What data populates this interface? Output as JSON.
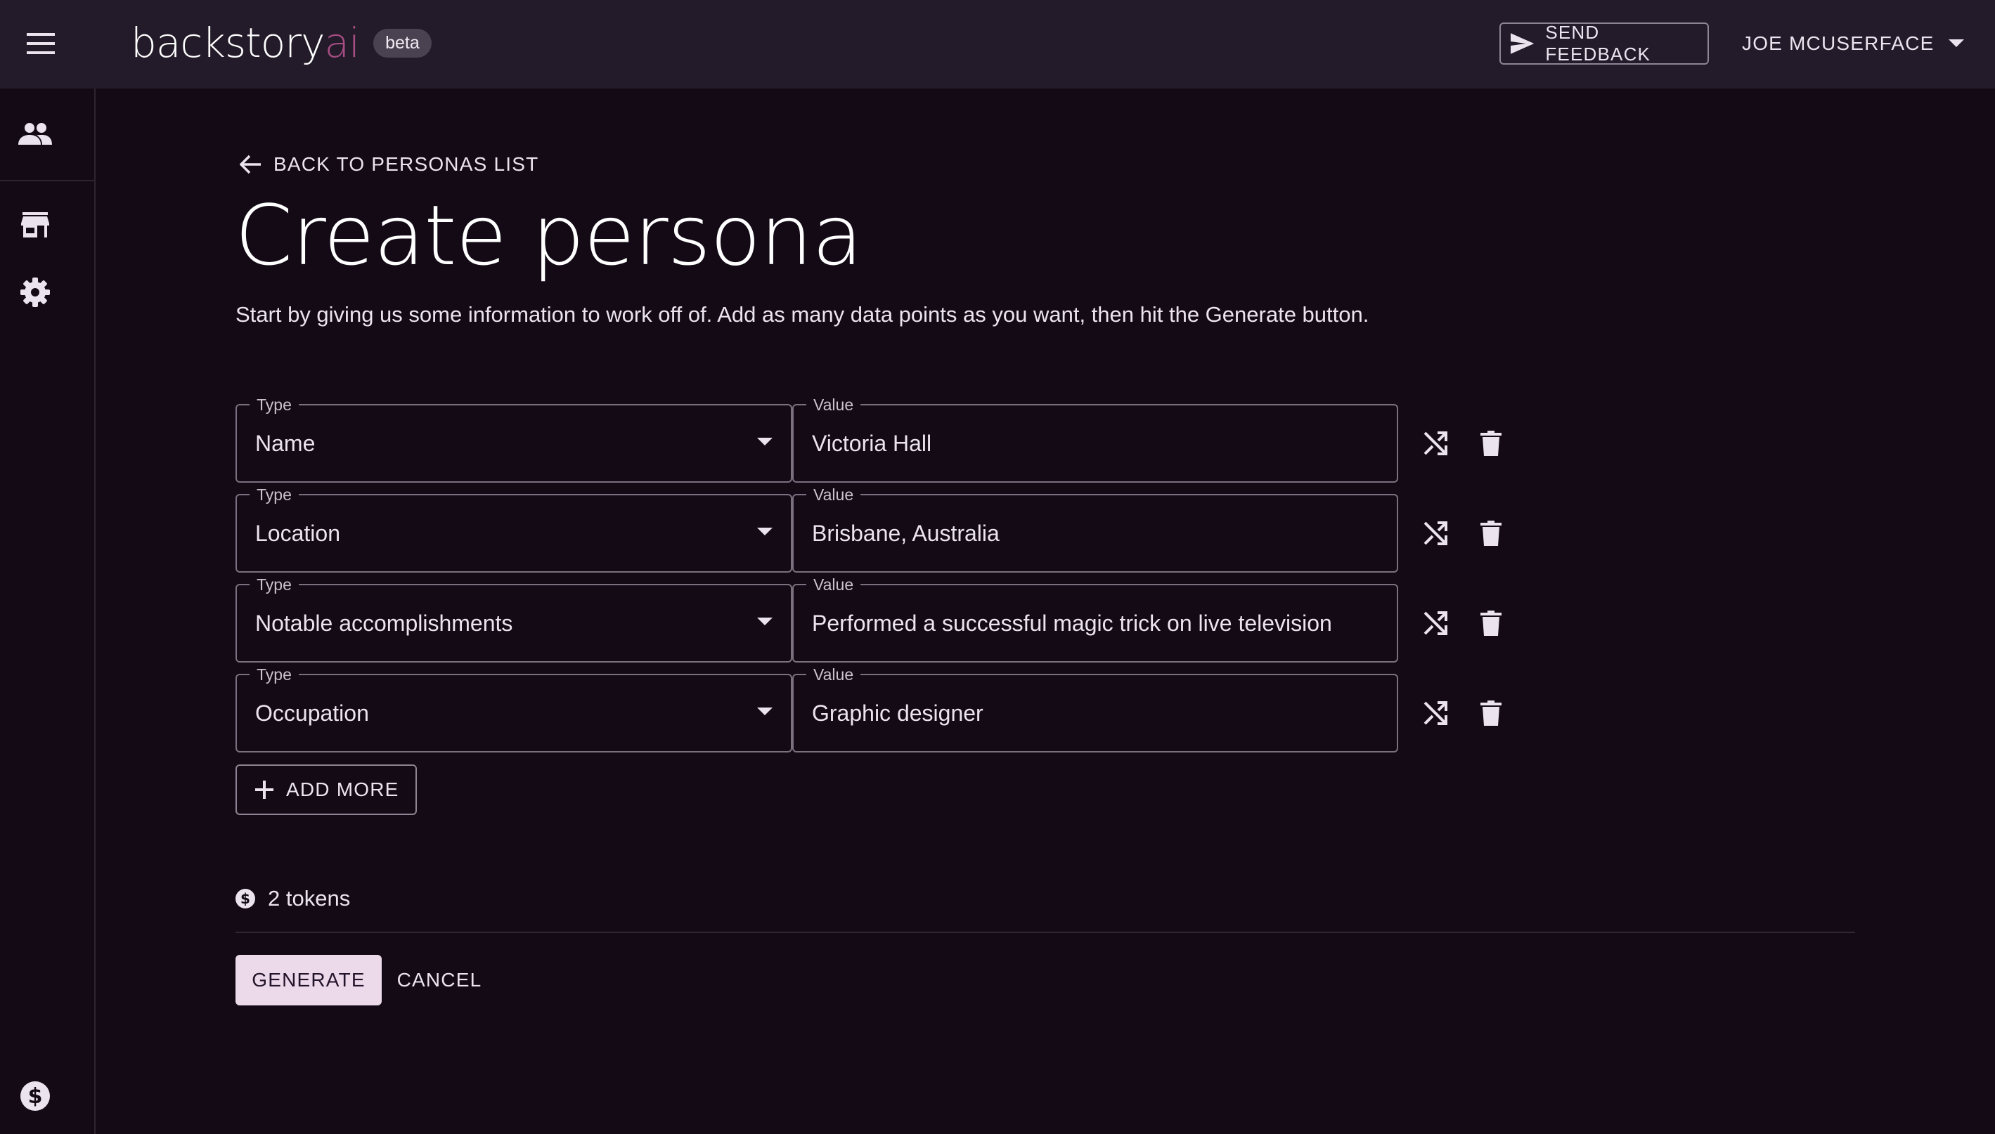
{
  "app": {
    "logo_main": "backstory",
    "logo_accent": "ai",
    "badge": "beta",
    "feedback_label": "SEND FEEDBACK",
    "user_name": "JOE MCUSERFACE"
  },
  "sidebar": {
    "items": [
      {
        "icon": "people-icon"
      },
      {
        "icon": "store-icon"
      },
      {
        "icon": "gear-icon"
      },
      {
        "icon": "dollar-circle-icon"
      }
    ]
  },
  "main": {
    "back_label": "BACK TO PERSONAS LIST",
    "title": "Create persona",
    "subtitle": "Start by giving us some information to work off of. Add as many data points as you want, then hit the Generate button.",
    "field_type_label": "Type",
    "field_value_label": "Value",
    "rows": [
      {
        "type": "Name",
        "value": "Victoria Hall"
      },
      {
        "type": "Location",
        "value": "Brisbane, Australia"
      },
      {
        "type": "Notable accomplishments",
        "value": "Performed a successful magic trick on live television"
      },
      {
        "type": "Occupation",
        "value": "Graphic designer"
      }
    ],
    "add_more_label": "ADD MORE",
    "tokens_label": "2 tokens",
    "generate_label": "GENERATE",
    "cancel_label": "CANCEL"
  },
  "colors": {
    "background": "#130a16",
    "appbar": "#231b29",
    "accent": "#a64d84",
    "primary_button": "#ecd9ea"
  }
}
